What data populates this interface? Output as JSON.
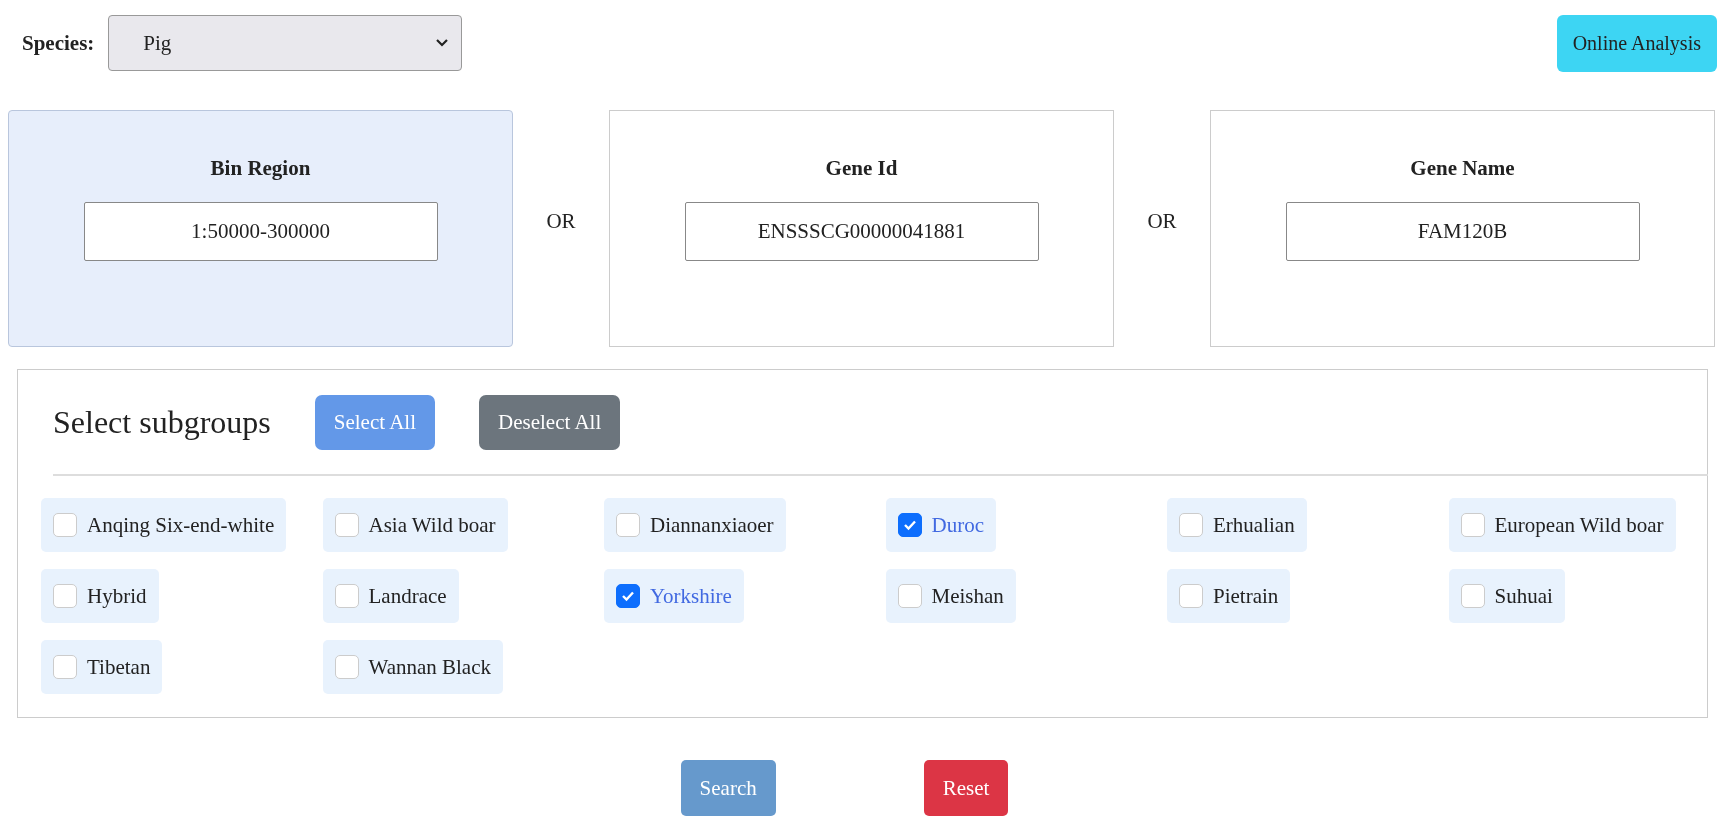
{
  "species": {
    "label": "Species:",
    "value": "Pig"
  },
  "online_analysis": "Online Analysis",
  "query_cards": [
    {
      "title": "Bin Region",
      "value": "1:50000-300000",
      "selected": true
    },
    {
      "title": "Gene Id",
      "value": "ENSSSCG00000041881",
      "selected": false
    },
    {
      "title": "Gene Name",
      "value": "FAM120B",
      "selected": false
    }
  ],
  "separators": [
    "OR",
    "OR"
  ],
  "subgroups": {
    "title": "Select subgroups",
    "select_all": "Select All",
    "deselect_all": "Deselect All",
    "items": [
      {
        "label": "Anqing Six-end-white",
        "checked": false
      },
      {
        "label": "Asia Wild boar",
        "checked": false
      },
      {
        "label": "Diannanxiaoer",
        "checked": false
      },
      {
        "label": "Duroc",
        "checked": true
      },
      {
        "label": "Erhualian",
        "checked": false
      },
      {
        "label": "European Wild boar",
        "checked": false
      },
      {
        "label": "Hybrid",
        "checked": false
      },
      {
        "label": "Landrace",
        "checked": false
      },
      {
        "label": "Yorkshire",
        "checked": true
      },
      {
        "label": "Meishan",
        "checked": false
      },
      {
        "label": "Pietrain",
        "checked": false
      },
      {
        "label": "Suhuai",
        "checked": false
      },
      {
        "label": "Tibetan",
        "checked": false
      },
      {
        "label": "Wannan Black",
        "checked": false
      }
    ]
  },
  "actions": {
    "search": "Search",
    "reset": "Reset"
  }
}
